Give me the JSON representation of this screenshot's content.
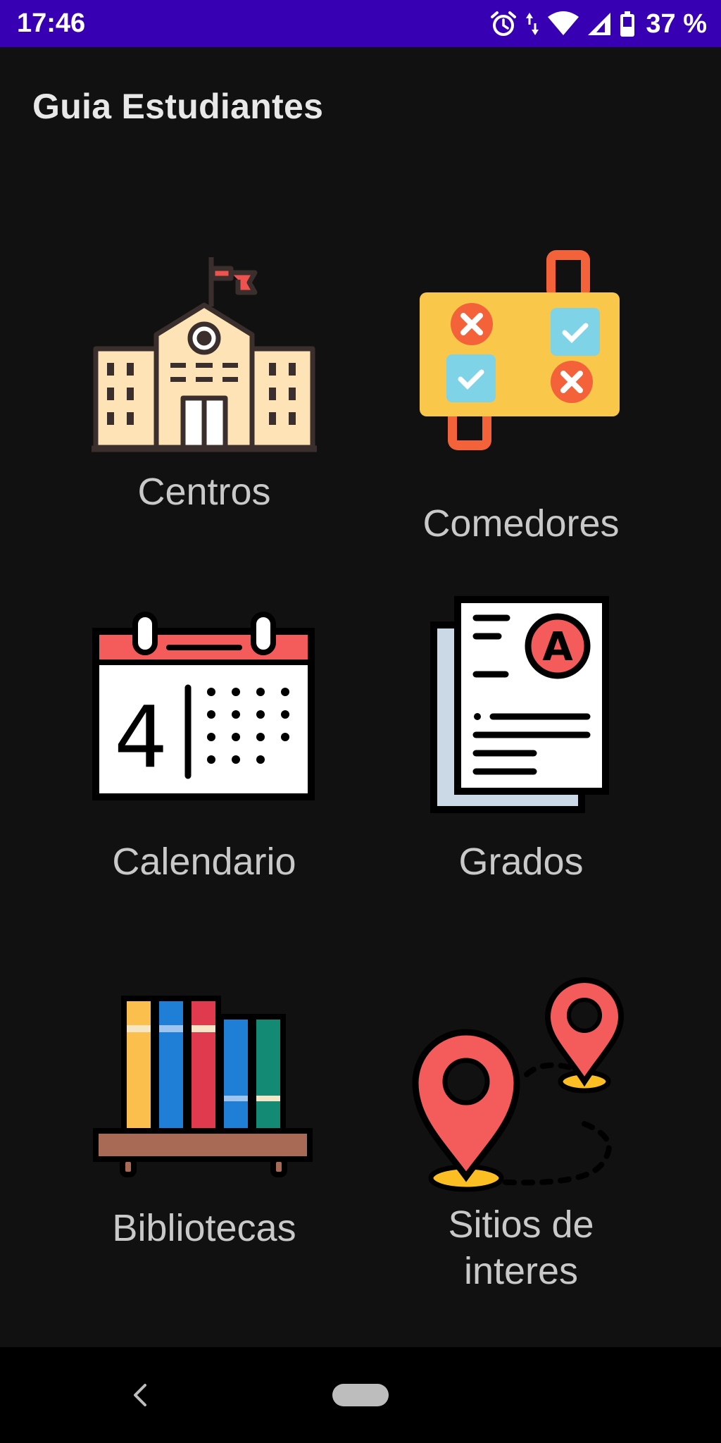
{
  "status_bar": {
    "time": "17:46",
    "battery_text": "37 %",
    "icons": [
      "alarm-icon",
      "data-arrows-icon",
      "wifi-icon",
      "cell-signal-icon",
      "battery-icon"
    ]
  },
  "app_bar": {
    "title": "Guia Estudiantes"
  },
  "menu": [
    {
      "id": "centros",
      "label": "Centros",
      "icon": "school-building-icon"
    },
    {
      "id": "comedores",
      "label": "Comedores",
      "icon": "food-tray-icon"
    },
    {
      "id": "calendario",
      "label": "Calendario",
      "icon": "calendar-icon"
    },
    {
      "id": "grados",
      "label": "Grados",
      "icon": "grade-document-icon"
    },
    {
      "id": "bibliotecas",
      "label": "Bibliotecas",
      "icon": "bookshelf-icon"
    },
    {
      "id": "sitios",
      "label_line1": "Sitios de",
      "label_line2": "interes",
      "icon": "map-pins-icon"
    }
  ],
  "calendar_icon_day": "4",
  "grade_icon_letter": "A",
  "nav_bar": {
    "icons": [
      "back-icon",
      "home-pill-icon"
    ]
  },
  "colors": {
    "status_bar": "#3700b3",
    "background": "#111111",
    "nav_bar": "#000000"
  }
}
